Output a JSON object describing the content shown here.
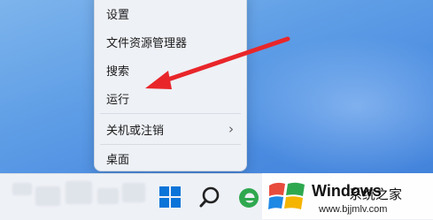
{
  "context_menu": {
    "items": [
      {
        "label": "设置",
        "has_submenu": false
      },
      {
        "label": "文件资源管理器",
        "has_submenu": false
      },
      {
        "label": "搜索",
        "has_submenu": false
      },
      {
        "label": "运行",
        "has_submenu": false
      },
      {
        "label": "关机或注销",
        "has_submenu": true
      },
      {
        "label": "桌面",
        "has_submenu": false
      }
    ],
    "chevron": "›"
  },
  "annotation": {
    "color": "#e8262a",
    "points_to": "运行"
  },
  "taskbar": {
    "icons": [
      "windows-start-icon",
      "search-icon",
      "edge-browser-icon"
    ],
    "accent": "#0067c0"
  },
  "watermark": {
    "brand": "Windows",
    "subtitle": "系统之家",
    "url": "www.bjjmlv.com",
    "logo": "windows-flag-logo"
  }
}
